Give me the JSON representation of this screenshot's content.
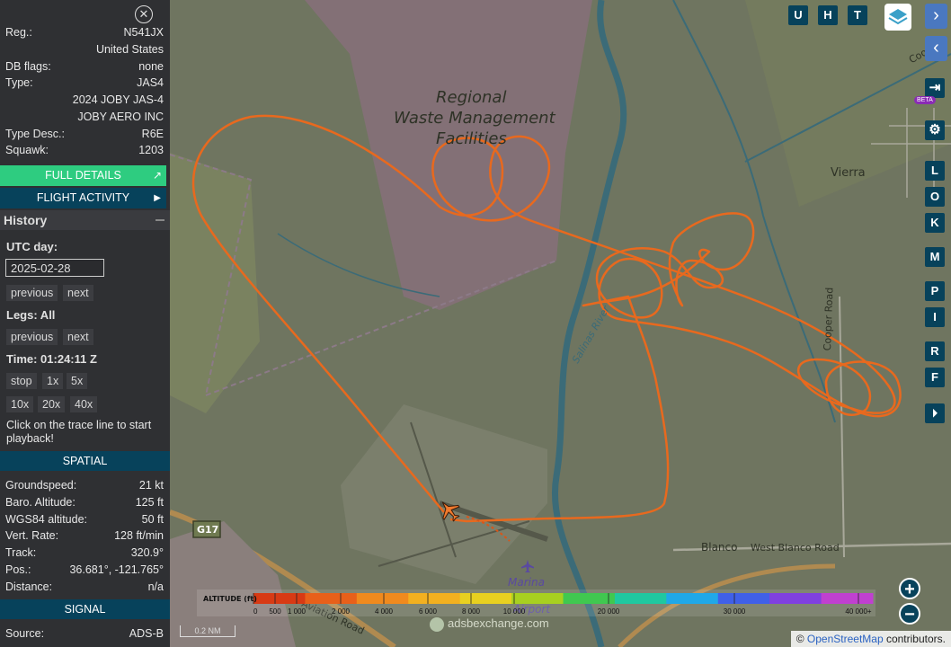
{
  "aircraft": {
    "reg_label": "Reg.:",
    "reg_value": "N541JX",
    "country": "United States",
    "dbflags_label": "DB flags:",
    "dbflags_value": "none",
    "type_label": "Type:",
    "type_value": "JAS4",
    "model": "2024 JOBY JAS-4",
    "operator": "JOBY AERO INC",
    "typedesc_label": "Type Desc.:",
    "typedesc_value": "R6E",
    "squawk_label": "Squawk:",
    "squawk_value": "1203"
  },
  "buttons": {
    "full_details": "FULL DETAILS",
    "flight_activity": "FLIGHT ACTIVITY"
  },
  "history": {
    "title": "History",
    "utc_day_label": "UTC day:",
    "date_value": "2025-02-28",
    "prev": "previous",
    "next": "next",
    "legs_label": "Legs: All",
    "time_label": "Time: 01:24:11 Z",
    "speeds": [
      "stop",
      "1x",
      "5x",
      "10x",
      "20x",
      "40x"
    ],
    "help": "Click on the trace line to start playback!"
  },
  "spatial": {
    "header": "SPATIAL",
    "rows": [
      {
        "label": "Groundspeed:",
        "value": "21 kt"
      },
      {
        "label": "Baro. Altitude:",
        "value": "125 ft"
      },
      {
        "label": "WGS84 altitude:",
        "value": "50 ft"
      },
      {
        "label": "Vert. Rate:",
        "value": "128 ft/min"
      },
      {
        "label": "Track:",
        "value": "320.9°"
      },
      {
        "label": "Pos.:",
        "value": "36.681°, -121.765°"
      },
      {
        "label": "Distance:",
        "value": "n/a"
      }
    ]
  },
  "signal": {
    "header": "SIGNAL",
    "source_label": "Source:",
    "source_value": "ADS-B"
  },
  "map_buttons": {
    "top": [
      "U",
      "H",
      "T"
    ],
    "side": [
      "L",
      "O",
      "K",
      "M",
      "P",
      "I",
      "R",
      "F"
    ],
    "beta": "BETA"
  },
  "map_labels": {
    "facility_line1": "Regional",
    "facility_line2": "Waste Management",
    "facility_line3": "Facilities",
    "vierra": "Vierra",
    "cooper_road": "Cooper Road",
    "salinas_river": "Salinas River",
    "blanco": "Blanco",
    "west_blanco_road": "West Blanco Road",
    "g17": "G17",
    "marina_l1": "Marina",
    "marina_l2": "Airport",
    "aviation_road": "Aviation Road",
    "cooper_short": "Coo"
  },
  "altitude_legend": {
    "title": "ALTITUDE (ft)",
    "ticks": [
      "0",
      "500",
      "1 000",
      "2 000",
      "4 000",
      "6 000",
      "8 000",
      "10 000",
      "20 000",
      "30 000",
      "40 000+"
    ],
    "colors": [
      "#d83a14",
      "#e8601a",
      "#f08a1e",
      "#f2b020",
      "#e8d020",
      "#a8d020",
      "#40c850",
      "#20c8a0",
      "#20a8e8",
      "#4060e8",
      "#8040e0",
      "#c040d0"
    ]
  },
  "scale_label": "0.2 NM",
  "watermark": "adsbexchange.com",
  "attribution": {
    "prefix": "© ",
    "link": "OpenStreetMap",
    "suffix": " contributors."
  },
  "colors": {
    "trace": "#e8691e",
    "sidebar": "#2f3033",
    "accent_teal": "#07425b",
    "accent_green": "#2ecc80"
  }
}
